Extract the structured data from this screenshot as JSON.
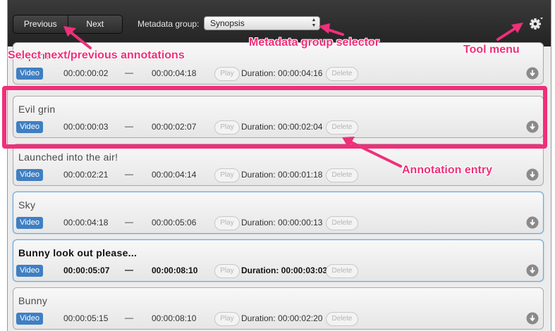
{
  "toolbar": {
    "previous_label": "Previous",
    "next_label": "Next",
    "metadata_group_label": "Metadata group:",
    "metadata_group_value": "Synopsis"
  },
  "annotations": [
    {
      "title": "Squirrel",
      "media": "Video",
      "start": "00:00:00:02",
      "dash": "—",
      "end": "00:00:04:18",
      "play": "Play",
      "duration": "Duration: 00:00:04:16",
      "delete": "Delete",
      "state": "normal"
    },
    {
      "title": "Evil grin",
      "media": "Video",
      "start": "00:00:00:03",
      "dash": "—",
      "end": "00:00:02:07",
      "play": "Play",
      "duration": "Duration: 00:00:02:04",
      "delete": "Delete",
      "state": "normal"
    },
    {
      "title": "Launched into the air!",
      "media": "Video",
      "start": "00:00:02:21",
      "dash": "—",
      "end": "00:00:04:14",
      "play": "Play",
      "duration": "Duration: 00:00:01:18",
      "delete": "Delete",
      "state": "normal"
    },
    {
      "title": "Sky",
      "media": "Video",
      "start": "00:00:04:18",
      "dash": "—",
      "end": "00:00:05:06",
      "play": "Play",
      "duration": "Duration: 00:00:00:13",
      "delete": "Delete",
      "state": "selected"
    },
    {
      "title": "Bunny look out please...",
      "media": "Video",
      "start": "00:00:05:07",
      "dash": "—",
      "end": "00:00:08:10",
      "play": "Play",
      "duration": "Duration: 00:00:03:03",
      "delete": "Delete",
      "state": "selected-bold"
    },
    {
      "title": "Bunny",
      "media": "Video",
      "start": "00:00:05:15",
      "dash": "—",
      "end": "00:00:08:10",
      "play": "Play",
      "duration": "Duration: 00:00:02:20",
      "delete": "Delete",
      "state": "normal"
    }
  ],
  "callouts": {
    "nav": "Select next/previous annotations",
    "group": "Metadata group selector",
    "menu": "Tool menu",
    "entry": "Annotation entry"
  },
  "colors": {
    "callout": "#ef2f7a",
    "media_badge": "#3f7fc2",
    "selected_border": "#6aa3d8"
  },
  "icons": {
    "tool_menu": "gear-icon",
    "select_arrows": "updown-arrows-icon",
    "row_action": "download-circle-icon"
  }
}
